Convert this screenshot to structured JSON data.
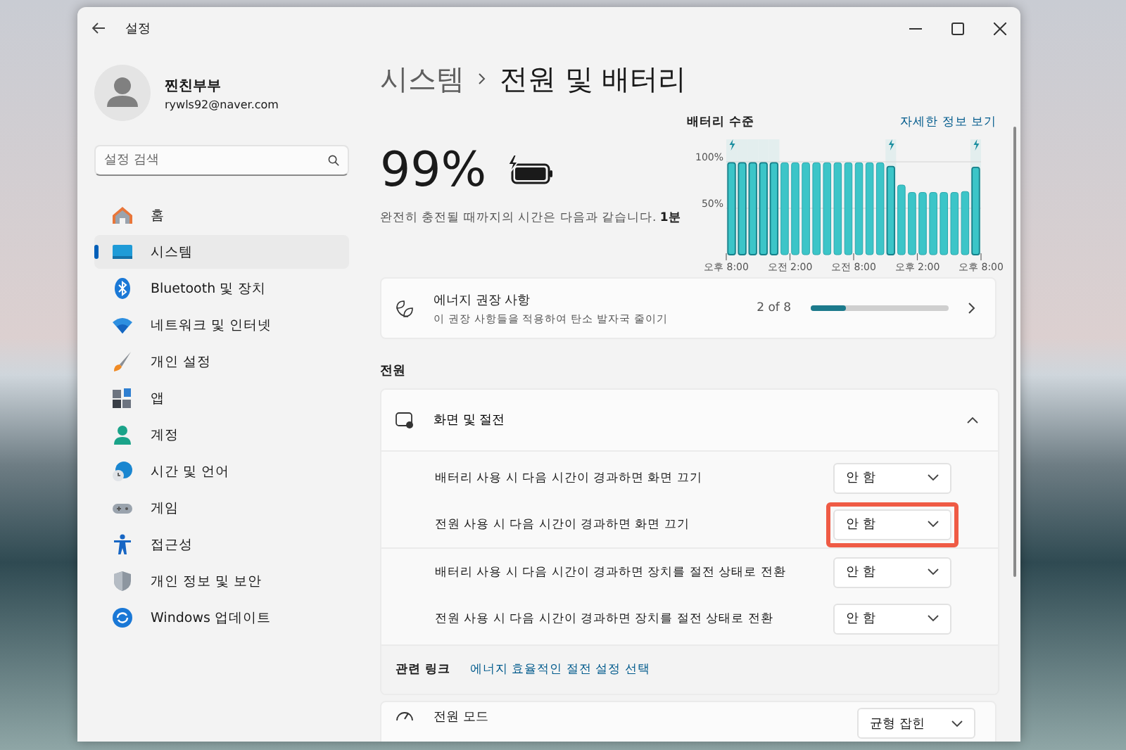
{
  "window": {
    "title": "설정"
  },
  "profile": {
    "name": "찐친부부",
    "email": "rywls92@naver.com"
  },
  "search": {
    "placeholder": "설정 검색"
  },
  "sidebar": {
    "items": [
      {
        "label": "홈",
        "kind": "home",
        "selected": false
      },
      {
        "label": "시스템",
        "kind": "system",
        "selected": true
      },
      {
        "label": "Bluetooth 및 장치",
        "kind": "bluetooth",
        "selected": false
      },
      {
        "label": "네트워크 및 인터넷",
        "kind": "network",
        "selected": false
      },
      {
        "label": "개인 설정",
        "kind": "brush",
        "selected": false
      },
      {
        "label": "앱",
        "kind": "apps",
        "selected": false
      },
      {
        "label": "계정",
        "kind": "account",
        "selected": false
      },
      {
        "label": "시간 및 언어",
        "kind": "time",
        "selected": false
      },
      {
        "label": "게임",
        "kind": "gaming",
        "selected": false
      },
      {
        "label": "접근성",
        "kind": "accessibility",
        "selected": false
      },
      {
        "label": "개인 정보 및 보안",
        "kind": "shield",
        "selected": false
      },
      {
        "label": "Windows 업데이트",
        "kind": "update",
        "selected": false
      }
    ]
  },
  "breadcrumb": {
    "parent": "시스템",
    "current": "전원 및 배터리"
  },
  "battery": {
    "percent": "99%",
    "charging": true,
    "level": 0.99,
    "note": "완전히 충전될 때까지의 시간은 다음과 같습니다. **1분**"
  },
  "battery_chart": {
    "link": "자세한 정보 보기",
    "bars": [
      {
        "charging": true
      },
      {
        "charging": true
      },
      {
        "charging": true
      },
      {
        "charging": true
      },
      {
        "charging": true
      },
      {
        "charging": false
      },
      {
        "charging": false
      },
      {
        "charging": false
      },
      {
        "charging": false
      },
      {
        "charging": false
      },
      {
        "charging": false
      },
      {
        "charging": false
      },
      {
        "charging": false
      },
      {
        "charging": false
      },
      {
        "charging": false
      },
      {
        "charging": true
      },
      {
        "charging": false
      },
      {
        "charging": false
      },
      {
        "charging": false
      },
      {
        "charging": false
      },
      {
        "charging": false
      },
      {
        "charging": false
      },
      {
        "charging": false
      },
      {
        "charging": true
      }
    ],
    "chart_data": {
      "type": "bar",
      "categories": [
        "오후 8:00",
        null,
        null,
        null,
        null,
        null,
        "오전 2:00",
        null,
        null,
        null,
        null,
        null,
        "오전 8:00",
        null,
        null,
        null,
        null,
        null,
        "오후 2:00",
        null,
        null,
        null,
        null,
        "오후 8:00"
      ],
      "series": [
        {
          "name": "배터리 수준",
          "color": "#3cc5c8",
          "values": [
            99,
            99,
            99,
            99,
            99,
            99,
            99,
            99,
            99,
            99,
            99,
            99,
            99,
            99,
            99,
            95,
            75,
            67,
            67,
            67,
            67,
            67,
            68,
            94
          ]
        }
      ],
      "ylim": [
        0,
        100
      ],
      "yticks": [
        {
          "value": 50,
          "label": "50%"
        },
        {
          "value": 100,
          "label": "100%"
        }
      ]
    }
  },
  "energy_card": {
    "title": "에너지 권장 사항",
    "subtitle": "이 권장 사항들을 적용하여 탄소 발자국 줄이기",
    "count": "2 of 8",
    "level": 0.25
  },
  "power_section": {
    "heading": "전원",
    "screen_sleep": {
      "title": "화면 및 절전",
      "expanded": true,
      "rows": [
        {
          "label": "배터리 사용 시 다음 시간이 경과하면 화면 끄기",
          "value": "안 함",
          "highlighted": false
        },
        {
          "label": "전원 사용 시 다음 시간이 경과하면 화면 끄기",
          "value": "안 함",
          "highlighted": true
        },
        {
          "label": "배터리 사용 시 다음 시간이 경과하면 장치를 절전 상태로 전환",
          "value": "안 함",
          "highlighted": false
        },
        {
          "label": "전원 사용 시 다음 시간이 경과하면 장치를 절전 상태로 전환",
          "value": "안 함",
          "highlighted": false
        }
      ]
    },
    "related": {
      "label": "관련 링크",
      "link": "에너지 효율적인 절전 설정 선택"
    },
    "power_mode": {
      "title": "전원 모드",
      "value": "균형 잡힌"
    }
  }
}
